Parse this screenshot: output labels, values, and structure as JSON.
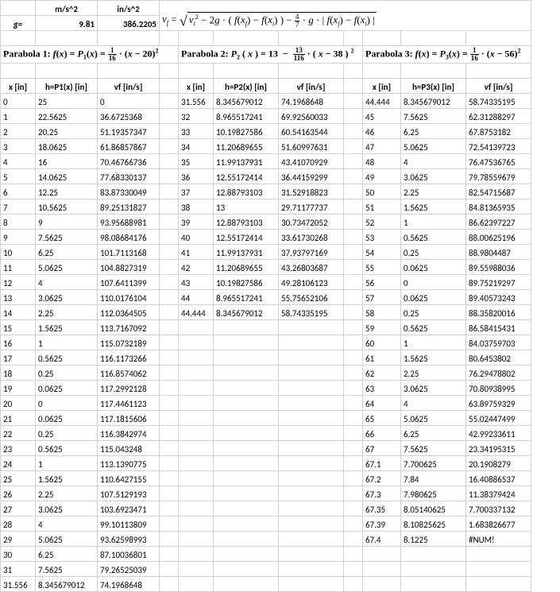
{
  "top": {
    "g_label": "g=",
    "units1": "m/s^2",
    "units2": "in/s^2",
    "g_ms2": "9.81",
    "g_ins2": "386.2205"
  },
  "sections": {
    "p1_prefix": "Parabola 1: ",
    "p2_prefix": "Parabola 2: ",
    "p3_prefix": "Parabola 3: "
  },
  "headers": {
    "x": "x [in]",
    "h1": "h=P1(x)  [in]",
    "h2": "h=P2(x)  [in]",
    "h3": "h=P3(x)  [in]",
    "vf": "vf [in/s]"
  },
  "table1": [
    [
      "0",
      "25",
      "0"
    ],
    [
      "1",
      "22.5625",
      "36.6725368"
    ],
    [
      "2",
      "20.25",
      "51.19357347"
    ],
    [
      "3",
      "18.0625",
      "61.86857867"
    ],
    [
      "4",
      "16",
      "70.46766736"
    ],
    [
      "5",
      "14.0625",
      "77.68330137"
    ],
    [
      "6",
      "12.25",
      "83.87330049"
    ],
    [
      "7",
      "10.5625",
      "89.25131827"
    ],
    [
      "8",
      "9",
      "93.95688981"
    ],
    [
      "9",
      "7.5625",
      "98.08684176"
    ],
    [
      "10",
      "6.25",
      "101.7113168"
    ],
    [
      "11",
      "5.0625",
      "104.8827319"
    ],
    [
      "12",
      "4",
      "107.6411399"
    ],
    [
      "13",
      "3.0625",
      "110.0176104"
    ],
    [
      "14",
      "2.25",
      "112.0364505"
    ],
    [
      "15",
      "1.5625",
      "113.7167092"
    ],
    [
      "16",
      "1",
      "115.0732189"
    ],
    [
      "17",
      "0.5625",
      "116.1173266"
    ],
    [
      "18",
      "0.25",
      "116.8574062"
    ],
    [
      "19",
      "0.0625",
      "117.2992128"
    ],
    [
      "20",
      "0",
      "117.4461123"
    ],
    [
      "21",
      "0.0625",
      "117.1815606"
    ],
    [
      "22",
      "0.25",
      "116.3842974"
    ],
    [
      "23",
      "0.5625",
      "115.043248"
    ],
    [
      "24",
      "1",
      "113.1390775"
    ],
    [
      "25",
      "1.5625",
      "110.6427155"
    ],
    [
      "26",
      "2.25",
      "107.5129193"
    ],
    [
      "27",
      "3.0625",
      "103.6923471"
    ],
    [
      "28",
      "4",
      "99.10113809"
    ],
    [
      "29",
      "5.0625",
      "93.62598993"
    ],
    [
      "30",
      "6.25",
      "87.10036801"
    ],
    [
      "31",
      "7.5625",
      "79.26525039"
    ],
    [
      "31.556",
      "8.345679012",
      "74.1968648"
    ]
  ],
  "table2": [
    [
      "31.556",
      "8.345679012",
      "74.1968648"
    ],
    [
      "32",
      "8.965517241",
      "69.92560033"
    ],
    [
      "33",
      "10.19827586",
      "60.54163544"
    ],
    [
      "34",
      "11.20689655",
      "51.60997631"
    ],
    [
      "35",
      "11.99137931",
      "43.41070929"
    ],
    [
      "36",
      "12.55172414",
      "36.44159299"
    ],
    [
      "37",
      "12.88793103",
      "31.52918823"
    ],
    [
      "38",
      "13",
      "29.71177737"
    ],
    [
      "39",
      "12.88793103",
      "30.73472052"
    ],
    [
      "40",
      "12.55172414",
      "33.61730268"
    ],
    [
      "41",
      "11.99137931",
      "37.93797169"
    ],
    [
      "42",
      "11.20689655",
      "43.26803687"
    ],
    [
      "43",
      "10.19827586",
      "49.28106123"
    ],
    [
      "44",
      "8.965517241",
      "55.75652106"
    ],
    [
      "44.444",
      "8.345679012",
      "58.74335195"
    ]
  ],
  "table3": [
    [
      "44.444",
      "8.345679012",
      "58.74335195"
    ],
    [
      "45",
      "7.5625",
      "62.31288297"
    ],
    [
      "46",
      "6.25",
      "67.8753182"
    ],
    [
      "47",
      "5.0625",
      "72.54139723"
    ],
    [
      "48",
      "4",
      "76.47536765"
    ],
    [
      "49",
      "3.0625",
      "79.78559679"
    ],
    [
      "50",
      "2.25",
      "82.54715687"
    ],
    [
      "51",
      "1.5625",
      "84.81365935"
    ],
    [
      "52",
      "1",
      "86.62397227"
    ],
    [
      "53",
      "0.5625",
      "88.00625196"
    ],
    [
      "54",
      "0.25",
      "88.9804487"
    ],
    [
      "55",
      "0.0625",
      "89.55988036"
    ],
    [
      "56",
      "0",
      "89.75219297"
    ],
    [
      "57",
      "0.0625",
      "89.40573243"
    ],
    [
      "58",
      "0.25",
      "88.35820016"
    ],
    [
      "59",
      "0.5625",
      "86.58415431"
    ],
    [
      "60",
      "1",
      "84.03759703"
    ],
    [
      "61",
      "1.5625",
      "80.6453802"
    ],
    [
      "62",
      "2.25",
      "76.29478802"
    ],
    [
      "63",
      "3.0625",
      "70.80938995"
    ],
    [
      "64",
      "4",
      "63.89759329"
    ],
    [
      "65",
      "5.0625",
      "55.02447499"
    ],
    [
      "66",
      "6.25",
      "42.99233611"
    ],
    [
      "67",
      "7.5625",
      "23.34195315"
    ],
    [
      "67.1",
      "7.700625",
      "20.1908279"
    ],
    [
      "67.2",
      "7.84",
      "16.40886537"
    ],
    [
      "67.3",
      "7.980625",
      "11.38379424"
    ],
    [
      "67.35",
      "8.05140625",
      "7.700337132"
    ],
    [
      "67.39",
      "8.10825625",
      "1.683826677"
    ],
    [
      "67.4",
      "8.1225",
      "#NUM!"
    ]
  ]
}
